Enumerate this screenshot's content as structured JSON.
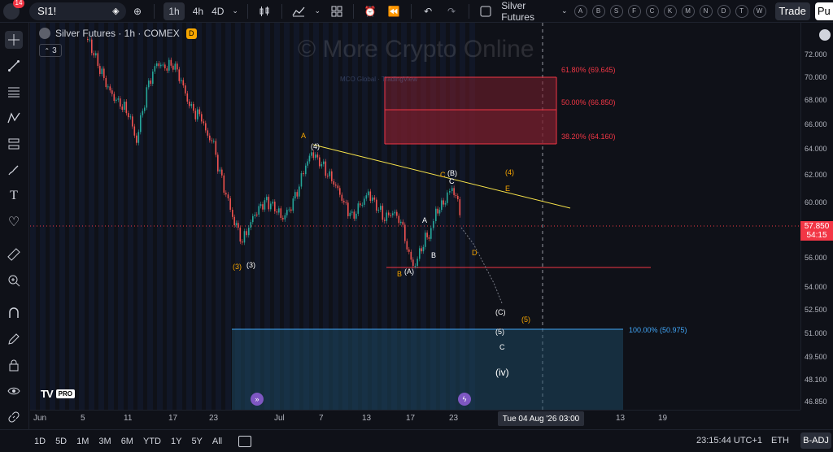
{
  "topbar": {
    "notification_count": "14",
    "symbol": "SI1!",
    "intervals": [
      "1h",
      "4h",
      "4D"
    ],
    "active_interval": "1h",
    "instrument_name": "Silver Futures",
    "letters": [
      "A",
      "B",
      "S",
      "F",
      "C",
      "K",
      "M",
      "N",
      "D",
      "T",
      "W"
    ],
    "trade_label": "Trade",
    "publish_label": "Pu"
  },
  "legend": {
    "title": "Silver Futures · 1h · COMEX",
    "badge": "D",
    "indicator_count": "3"
  },
  "watermark": "© More Crypto Online",
  "watermark_sub": "MCO Global · TradingView",
  "price_axis": [
    "72.000",
    "70.000",
    "68.000",
    "66.000",
    "64.000",
    "62.000",
    "60.000",
    "58.000",
    "56.000",
    "54.000",
    "52.500",
    "51.000",
    "49.500",
    "48.100",
    "46.850"
  ],
  "current_price": "57.850",
  "countdown": "54:15",
  "time_axis": [
    "Jun",
    "5",
    "11",
    "17",
    "23",
    "Jul",
    "7",
    "13",
    "17",
    "23",
    "13",
    "19"
  ],
  "crosshair_date": "Tue 04 Aug '26   03:00",
  "fib_levels": [
    {
      "label": "61.80% (69.645)",
      "color": "#f23645"
    },
    {
      "label": "50.00% (66.850)",
      "color": "#f23645"
    },
    {
      "label": "38.20% (64.160)",
      "color": "#f23645"
    },
    {
      "label": "100.00% (50.975)",
      "color": "#42a5f5"
    }
  ],
  "wave_labels": {
    "orange": [
      "(3)",
      "A",
      "B",
      "C",
      "(4)",
      "E",
      "D",
      "(5)"
    ],
    "white": [
      "(3)",
      "(4)",
      "(A)",
      "A",
      "B",
      "(B)",
      "C",
      "(C)",
      "(5)",
      "C",
      "(iv)"
    ]
  },
  "tv_logo": {
    "mark": "TV",
    "pro": "PRO"
  },
  "bottombar": {
    "ranges": [
      "1D",
      "5D",
      "1M",
      "3M",
      "6M",
      "YTD",
      "1Y",
      "5Y",
      "All"
    ],
    "clock": "23:15:44 UTC+1",
    "session": "ETH",
    "adjust": "B-ADJ"
  },
  "colors": {
    "up": "#26a69a",
    "down": "#ef5350",
    "trendline": "#f7e34a",
    "support": "#f23645",
    "fib_box": "#7a1f2e",
    "target_box": "#1e4c66"
  }
}
